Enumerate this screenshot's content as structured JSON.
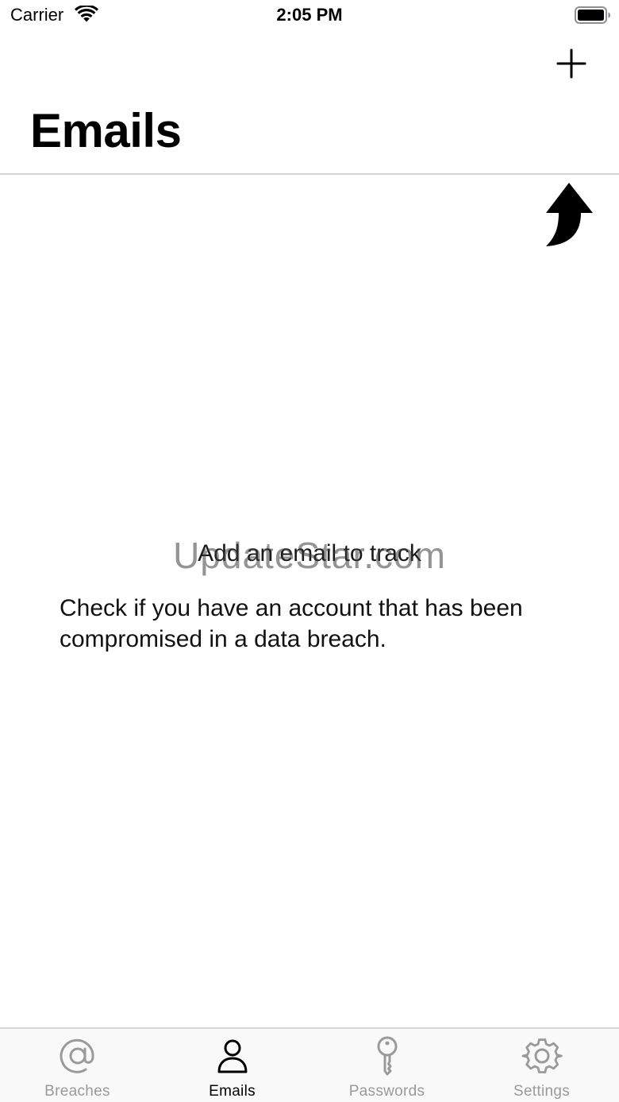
{
  "status_bar": {
    "carrier": "Carrier",
    "time": "2:05 PM",
    "wifi_icon": "wifi-icon",
    "battery_icon": "battery-icon"
  },
  "nav": {
    "add_icon": "plus-icon",
    "title": "Emails"
  },
  "empty_state": {
    "hint_icon": "curved-up-arrow-icon",
    "title": "Add an email to track",
    "message": "Check if you have an account that has been compromised in a data breach.",
    "watermark": "UpdateStar.com"
  },
  "tab_bar": {
    "active_color": "#000000",
    "inactive_color": "#9a9a9a",
    "tabs": [
      {
        "label": "Breaches",
        "icon": "at-sign-icon",
        "active": false
      },
      {
        "label": "Emails",
        "icon": "person-icon",
        "active": true
      },
      {
        "label": "Passwords",
        "icon": "key-icon",
        "active": false
      },
      {
        "label": "Settings",
        "icon": "gear-icon",
        "active": false
      }
    ]
  }
}
